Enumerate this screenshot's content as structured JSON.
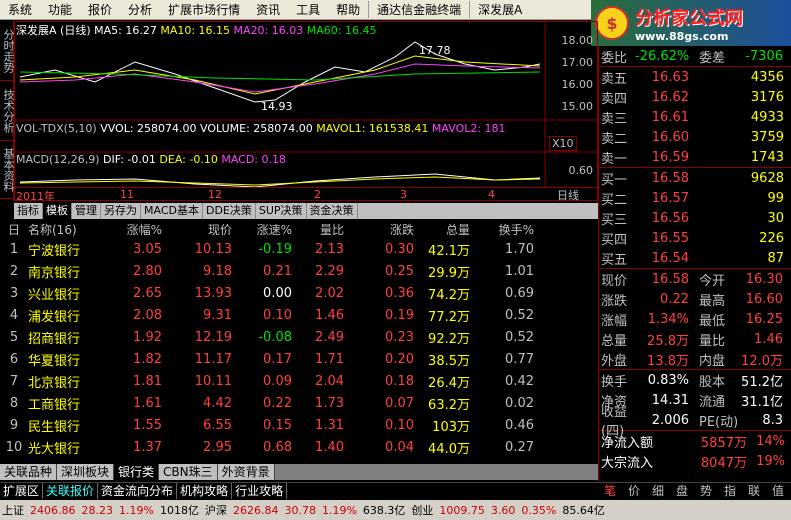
{
  "menu": [
    "系统",
    "功能",
    "报价",
    "分析",
    "扩展市场行情",
    "资讯",
    "工具",
    "帮助"
  ],
  "menu_right": [
    "通达信金融终端",
    "深发展A"
  ],
  "close_label": "×",
  "brand": {
    "title": "分析家公式网",
    "url": "www.88gs.com"
  },
  "side_tabs": [
    "分时走势",
    "技术分析",
    "基本资料"
  ],
  "chart": {
    "stock": "深发展A (日线)",
    "ma5": "MA5: 16.27",
    "ma10": "MA10: 16.15",
    "ma20": "MA20: 16.03",
    "ma60": "MA60: 16.45",
    "high_mark": "17.78",
    "low_mark": "14.93",
    "y_ticks": [
      "18.00",
      "17.00",
      "16.00",
      "15.00"
    ],
    "vol_title": "VOL-TDX(5,10)",
    "vvol": "VVOL: 258074.00",
    "volume": "VOLUME: 258074.00",
    "mavol1": "MAVOL1: 161538.41",
    "mavol2": "MAVOL2: 181",
    "x10": "X10",
    "macd_title": "MACD(12,26,9)",
    "dif": "DIF: -0.01",
    "dea": "DEA: -0.10",
    "macd": "MACD: 0.18",
    "macd_tick": "0.60",
    "dates": [
      "2011年",
      "11",
      "12",
      "2",
      "3",
      "4"
    ],
    "period": "日线"
  },
  "toolbar": [
    "指标",
    "模板",
    "管理",
    "另存为",
    "MACD基本",
    "DDE决策",
    "SUP决策",
    "资金决策"
  ],
  "table": {
    "headers": [
      "名称(16)",
      "涨幅%",
      "现价",
      "涨速%",
      "量比",
      "涨跌",
      "总量",
      "换手%"
    ],
    "rows": [
      {
        "n": "1",
        "name": "宁波银行",
        "chg": "3.05",
        "price": "10.13",
        "speed": "-0.19",
        "ratio": "2.13",
        "updown": "0.30",
        "vol": "42.1万",
        "turn": "1.70",
        "sc": "green"
      },
      {
        "n": "2",
        "name": "南京银行",
        "chg": "2.80",
        "price": "9.18",
        "speed": "0.21",
        "ratio": "2.29",
        "updown": "0.25",
        "vol": "29.9万",
        "turn": "1.01",
        "sc": "red"
      },
      {
        "n": "3",
        "name": "兴业银行",
        "chg": "2.65",
        "price": "13.93",
        "speed": "0.00",
        "ratio": "2.02",
        "updown": "0.36",
        "vol": "74.2万",
        "turn": "0.69",
        "sc": "white"
      },
      {
        "n": "4",
        "name": "浦发银行",
        "chg": "2.08",
        "price": "9.31",
        "speed": "0.10",
        "ratio": "1.46",
        "updown": "0.19",
        "vol": "77.2万",
        "turn": "0.52",
        "sc": "red"
      },
      {
        "n": "5",
        "name": "招商银行",
        "chg": "1.92",
        "price": "12.19",
        "speed": "-0.08",
        "ratio": "2.49",
        "updown": "0.23",
        "vol": "92.2万",
        "turn": "0.52",
        "sc": "green"
      },
      {
        "n": "6",
        "name": "华夏银行",
        "chg": "1.82",
        "price": "11.17",
        "speed": "0.17",
        "ratio": "1.71",
        "updown": "0.20",
        "vol": "38.5万",
        "turn": "0.77",
        "sc": "red"
      },
      {
        "n": "7",
        "name": "北京银行",
        "chg": "1.81",
        "price": "10.11",
        "speed": "0.09",
        "ratio": "2.04",
        "updown": "0.18",
        "vol": "26.4万",
        "turn": "0.42",
        "sc": "red"
      },
      {
        "n": "8",
        "name": "工商银行",
        "chg": "1.61",
        "price": "4.42",
        "speed": "0.22",
        "ratio": "1.73",
        "updown": "0.07",
        "vol": "63.2万",
        "turn": "0.02",
        "sc": "red"
      },
      {
        "n": "9",
        "name": "民生银行",
        "chg": "1.55",
        "price": "6.55",
        "speed": "0.15",
        "ratio": "1.31",
        "updown": "0.10",
        "vol": "103万",
        "turn": "0.46",
        "sc": "red"
      },
      {
        "n": "10",
        "name": "光大银行",
        "chg": "1.37",
        "price": "2.95",
        "speed": "0.68",
        "ratio": "1.40",
        "updown": "0.04",
        "vol": "44.0万",
        "turn": "0.27",
        "sc": "red"
      }
    ]
  },
  "bottom_tabs": [
    "关联品种",
    "深圳板块",
    "银行类",
    "CBN珠三",
    "外资背景"
  ],
  "nav": [
    "扩展区",
    "关联报价",
    "资金流向分布",
    "机构攻略",
    "行业攻略"
  ],
  "status": {
    "sh_label": "上证",
    "sh": "2406.86",
    "sh_chg": "28.23",
    "sh_pct": "1.19%",
    "sh_amt": "1018亿",
    "hs_label": "沪深",
    "hs": "2626.84",
    "hs_chg": "30.78",
    "hs_pct": "1.19%",
    "hs_amt": "638.3亿",
    "cy_label": "创业",
    "cy": "1009.75",
    "cy_chg": "3.60",
    "cy_pct": "0.35%",
    "cy_amt": "85.64亿"
  },
  "right": {
    "weibi_label": "委比",
    "weibi": "-26.62%",
    "weicha_label": "委差",
    "weicha": "-7306",
    "sells": [
      {
        "k": "卖五",
        "p": "16.63",
        "v": "4356"
      },
      {
        "k": "卖四",
        "p": "16.62",
        "v": "3176"
      },
      {
        "k": "卖三",
        "p": "16.61",
        "v": "4933"
      },
      {
        "k": "卖二",
        "p": "16.60",
        "v": "3759"
      },
      {
        "k": "卖一",
        "p": "16.59",
        "v": "1743"
      }
    ],
    "buys": [
      {
        "k": "买一",
        "p": "16.58",
        "v": "9628"
      },
      {
        "k": "买二",
        "p": "16.57",
        "v": "99"
      },
      {
        "k": "买三",
        "p": "16.56",
        "v": "30"
      },
      {
        "k": "买四",
        "p": "16.55",
        "v": "226"
      },
      {
        "k": "买五",
        "p": "16.54",
        "v": "87"
      }
    ],
    "quote": [
      [
        "现价",
        "16.58",
        "今开",
        "16.30"
      ],
      [
        "涨跌",
        "0.22",
        "最高",
        "16.60"
      ],
      [
        "涨幅",
        "1.34%",
        "最低",
        "16.25"
      ],
      [
        "总量",
        "25.8万",
        "量比",
        "1.46"
      ],
      [
        "外盘",
        "13.8万",
        "内盘",
        "12.0万"
      ]
    ],
    "fund": [
      [
        "换手",
        "0.83%",
        "股本",
        "51.2亿"
      ],
      [
        "净资",
        "14.31",
        "流通",
        "31.1亿"
      ],
      [
        "收益(四)",
        "2.006",
        "PE(动)",
        "8.3"
      ]
    ],
    "flow": [
      {
        "k": "净流入额",
        "v": "5857万",
        "p": "14%"
      },
      {
        "k": "大宗流入",
        "v": "8047万",
        "p": "19%"
      }
    ],
    "tabs": [
      "笔",
      "价",
      "细",
      "盘",
      "势",
      "指",
      "联",
      "值"
    ]
  }
}
